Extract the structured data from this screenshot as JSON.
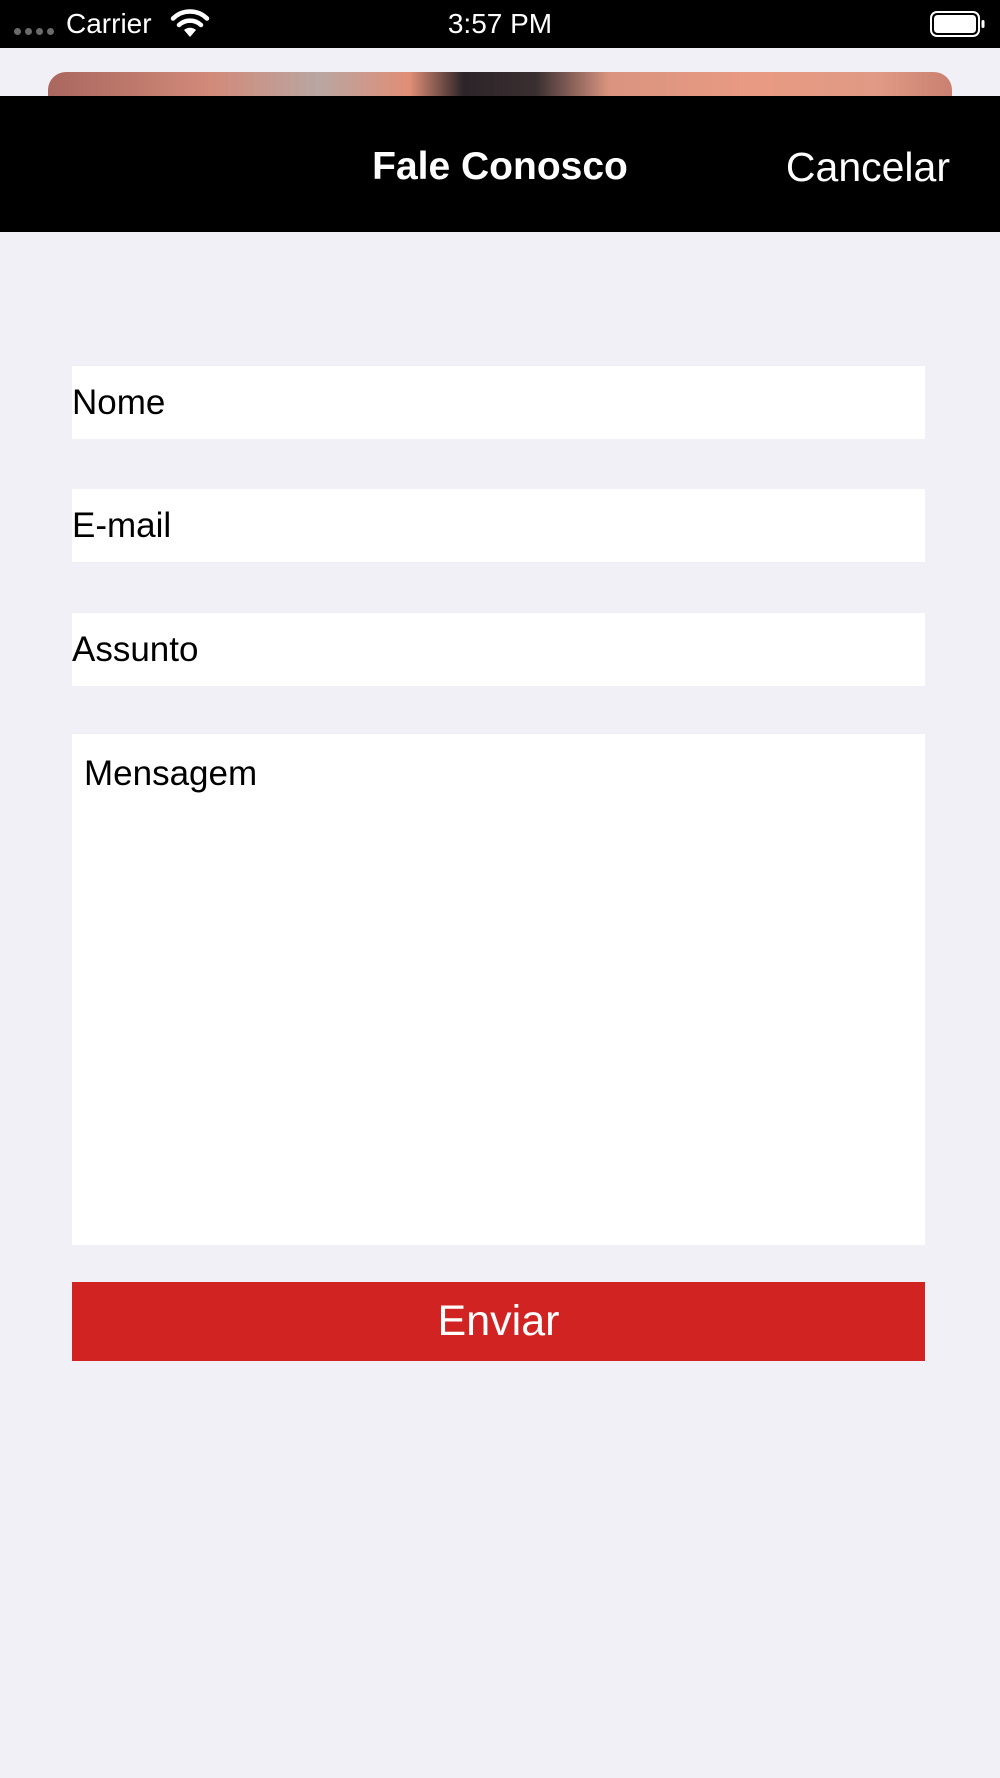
{
  "status_bar": {
    "carrier": "Carrier",
    "time": "3:57 PM",
    "icons": [
      "signal-dots-icon",
      "wifi-icon",
      "battery-icon"
    ]
  },
  "nav": {
    "title": "Fale Conosco",
    "cancel_label": "Cancelar"
  },
  "form": {
    "name_placeholder": "Nome",
    "email_placeholder": "E-mail",
    "subject_placeholder": "Assunto",
    "message_placeholder": "Mensagem",
    "send_label": "Enviar"
  },
  "colors": {
    "nav_background": "#000000",
    "page_background": "#f1f0f6",
    "field_background": "#ffffff",
    "send_button": "#d02322"
  }
}
